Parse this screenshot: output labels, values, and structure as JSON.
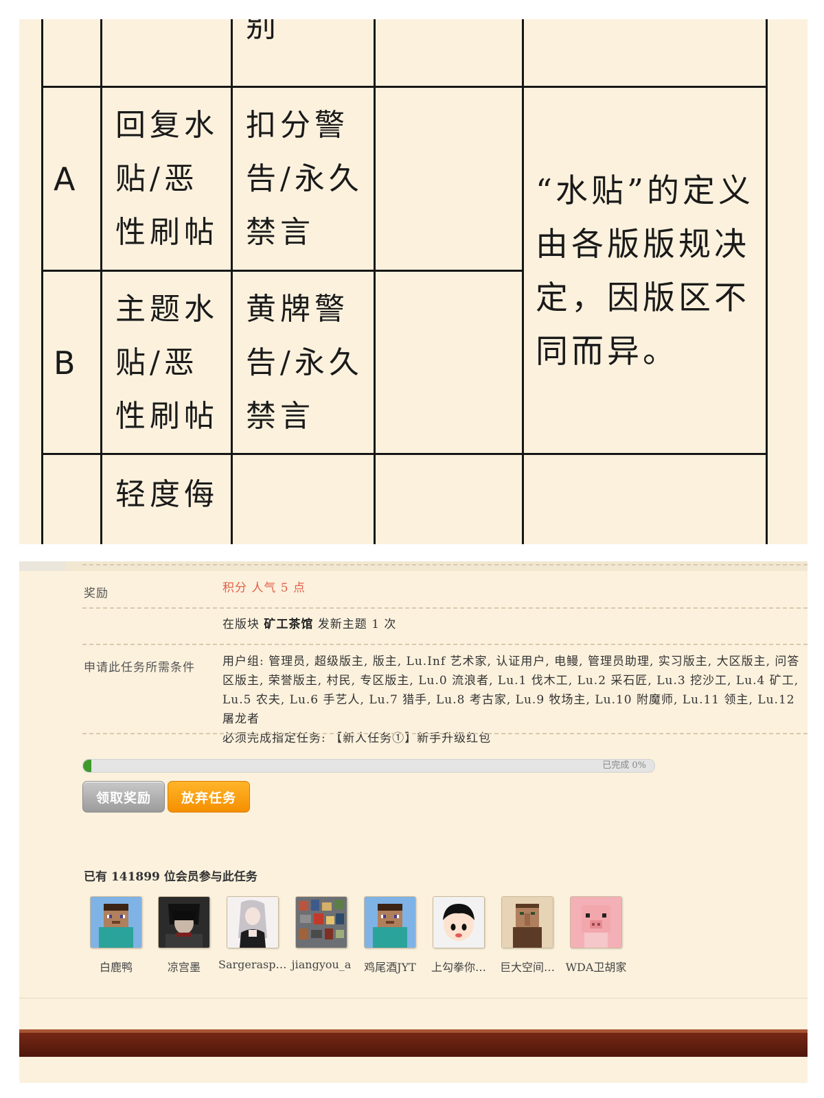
{
  "table": {
    "partial_top": "别",
    "rows": [
      {
        "grade": "A",
        "behavior": "回复水\n贴/恶\n性刷帖",
        "penalty": "扣分警\n告/永久\n禁言"
      },
      {
        "grade": "B",
        "behavior": "主题水\n贴/恶\n性刷帖",
        "penalty": "黄牌警\n告/永久\n禁言"
      },
      {
        "grade": "",
        "behavior": "轻度侮",
        "penalty": ""
      }
    ],
    "note": "“水贴”的定义\n由各版版规决\n定，因版区不\n同而异。"
  },
  "task": {
    "reward_label": "奖励",
    "reward_value": "积分 人气 5 点",
    "condition_prefix": "在版块 ",
    "condition_board": "矿工茶馆",
    "condition_suffix": " 发新主题 1 次",
    "requirements_label": "申请此任务所需条件",
    "requirements_groups": "用户组: 管理员, 超级版主, 版主, Lu.Inf 艺术家, 认证用户, 电鳗, 管理员助理, 实习版主, 大区版主, 问答区版主, 荣誉版主, 村民, 专区版主, Lu.0 流浪者, Lu.1 伐木工, Lu.2 采石匠, Lu.3 挖沙工, Lu.4 矿工, Lu.5 农夫, Lu.6 手艺人, Lu.7 猎手, Lu.8 考古家, Lu.9 牧场主, Lu.10 附魔师, Lu.11 领主, Lu.12 屠龙者",
    "requirements_task": "必须完成指定任务: 【新人任务①】新手升级红包",
    "progress_text": "已完成 0%",
    "progress": 0.0,
    "claim_button": "领取奖励",
    "abandon_button": "放弃任务",
    "participants_title": "已有 141899 位会员参与此任务",
    "members": [
      {
        "name": "白鹿鸭",
        "avatar": "steve-avatar-icon"
      },
      {
        "name": "凉宫墨",
        "avatar": "dark-character-avatar-icon"
      },
      {
        "name": "Sargerasplus",
        "avatar": "anime-girl-avatar-icon"
      },
      {
        "name": "jiangyou_a",
        "avatar": "pixel-collage-avatar-icon"
      },
      {
        "name": "鸡尾酒JYT",
        "avatar": "steve-avatar-icon"
      },
      {
        "name": "上勾拳你…",
        "avatar": "cartoon-face-avatar-icon"
      },
      {
        "name": "巨大空间…",
        "avatar": "villager-avatar-icon"
      },
      {
        "name": "WDA卫胡家",
        "avatar": "pig-avatar-icon"
      }
    ]
  },
  "colors": {
    "paper": "#fbf1dd",
    "reward_red": "#e2604a",
    "abandon_orange": "#f58f00",
    "progress_green": "#3f9a2c",
    "footer_brown": "#5e1d0d"
  }
}
